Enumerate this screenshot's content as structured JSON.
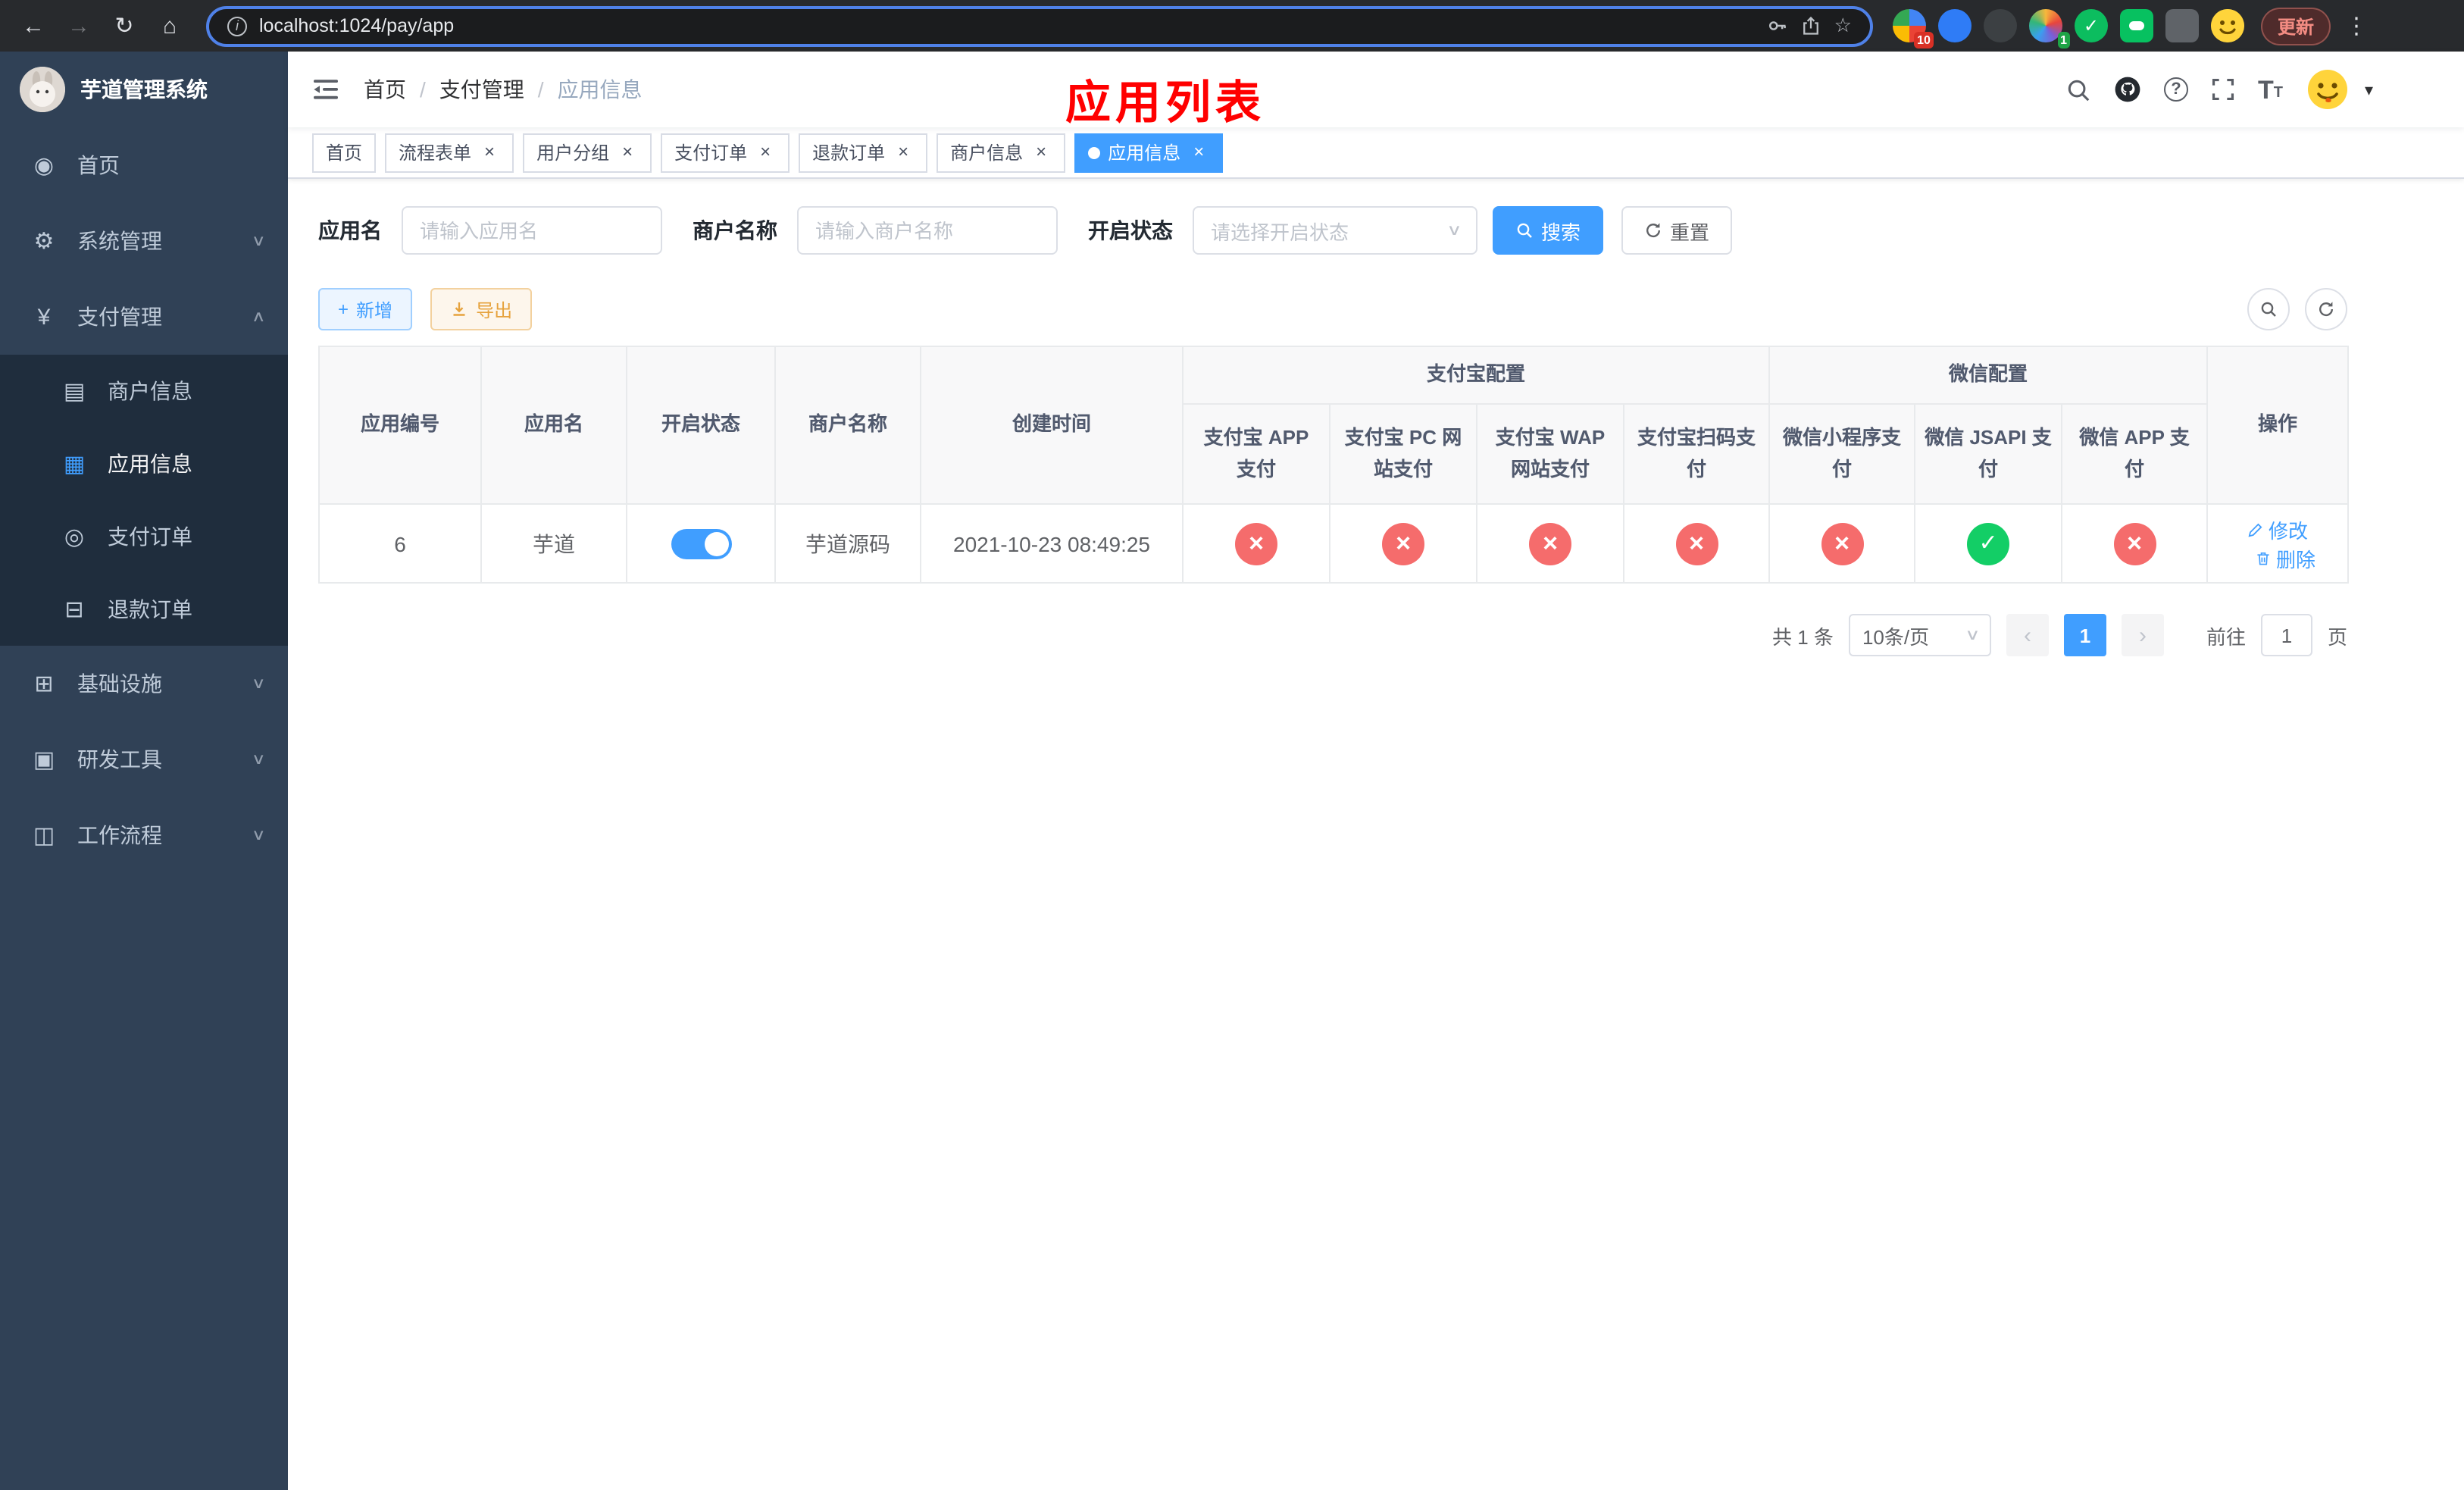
{
  "browser": {
    "url": "localhost:1024/pay/app",
    "update_label": "更新",
    "extension_badges": {
      "first": "10",
      "second": "1"
    }
  },
  "icons": {
    "back": "←",
    "forward": "→",
    "reload": "↻",
    "home": "⌂",
    "bookmark_star": "☆",
    "browser_menu": "⋮",
    "dashboard": "◉",
    "gear": "⚙",
    "yen": "¥",
    "merchant_card": "▤",
    "app_grid": "▦",
    "order_circle": "◎",
    "refund_doc": "⊟",
    "infrastructure": "⊞",
    "dev_tools": "▣",
    "workflow": "◫",
    "chevron_down": "∨",
    "chevron_up": "∧",
    "caret_down": "▾",
    "plus": "+",
    "download": "↓",
    "prev": "‹",
    "next": "›",
    "close": "×"
  },
  "sidebar": {
    "title": "芋道管理系统",
    "items": [
      {
        "label": "首页"
      },
      {
        "label": "系统管理"
      },
      {
        "label": "支付管理"
      },
      {
        "label": "基础设施"
      },
      {
        "label": "研发工具"
      },
      {
        "label": "工作流程"
      }
    ],
    "payment_submenu": [
      {
        "label": "商户信息"
      },
      {
        "label": "应用信息"
      },
      {
        "label": "支付订单"
      },
      {
        "label": "退款订单"
      }
    ]
  },
  "header": {
    "separator": "/",
    "breadcrumb": [
      {
        "label": "首页"
      },
      {
        "label": "支付管理"
      },
      {
        "label": "应用信息"
      }
    ],
    "annotation": "应用列表"
  },
  "tabs": [
    {
      "label": "首页"
    },
    {
      "label": "流程表单"
    },
    {
      "label": "用户分组"
    },
    {
      "label": "支付订单"
    },
    {
      "label": "退款订单"
    },
    {
      "label": "商户信息"
    },
    {
      "label": "应用信息"
    }
  ],
  "filters": {
    "app_name": {
      "label": "应用名",
      "placeholder": "请输入应用名",
      "value": ""
    },
    "merchant_name": {
      "label": "商户名称",
      "placeholder": "请输入商户名称",
      "value": ""
    },
    "status": {
      "label": "开启状态",
      "placeholder": "请选择开启状态"
    },
    "search_label": "搜索",
    "reset_label": "重置"
  },
  "toolbar": {
    "add_label": "新增",
    "export_label": "导出"
  },
  "table": {
    "columns": {
      "app_id": "应用编号",
      "app_name": "应用名",
      "status": "开启状态",
      "merchant_name": "商户名称",
      "create_time": "创建时间",
      "alipay_group": "支付宝配置",
      "wechat_group": "微信配置",
      "alipay_app": "支付宝 APP 支付",
      "alipay_pc": "支付宝 PC 网站支付",
      "alipay_wap": "支付宝 WAP 网站支付",
      "alipay_qr": "支付宝扫码支付",
      "wechat_mini": "微信小程序支付",
      "wechat_jsapi": "微信 JSAPI 支付",
      "wechat_app": "微信 APP 支付",
      "actions": "操作"
    },
    "rows": [
      {
        "app_id": "6",
        "app_name": "芋道",
        "status": "on",
        "merchant_name": "芋道源码",
        "create_time": "2021-10-23 08:49:25",
        "alipay_app": "disabled",
        "alipay_pc": "disabled",
        "alipay_wap": "disabled",
        "alipay_qr": "disabled",
        "wechat_mini": "disabled",
        "wechat_jsapi": "enabled",
        "wechat_app": "disabled",
        "edit_label": "修改",
        "delete_label": "删除"
      }
    ]
  },
  "pagination": {
    "total_text": "共 1 条",
    "page_size_text": "10条/页",
    "current_page": "1",
    "goto_prefix": "前往",
    "goto_value": "1",
    "goto_suffix": "页"
  },
  "colors": {
    "primary": "#409eff",
    "danger": "#f56c6c",
    "success": "#13ce66",
    "warning": "#e6a23c",
    "annotation_red": "#ff0000",
    "sidebar_bg": "#304156",
    "sidebar_submenu_bg": "#1f2d3d"
  }
}
